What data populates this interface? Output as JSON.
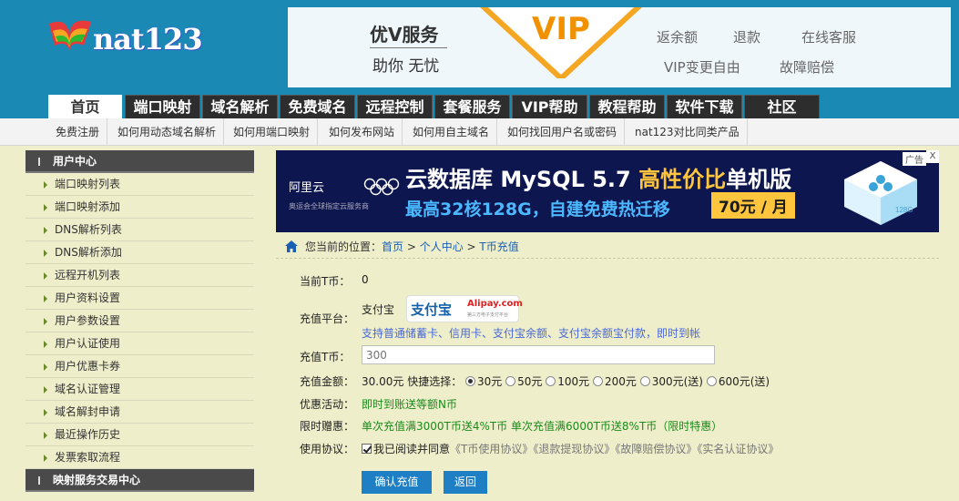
{
  "logo": {
    "text": "nat123"
  },
  "vip_banner": {
    "title": "优V服务",
    "subtitle": "助你 无忧",
    "badge": "VIP",
    "links": [
      "返余额",
      "退款",
      "在线客服",
      "VIP变更自由",
      "故障赔偿"
    ]
  },
  "nav": {
    "tabs": [
      "首页",
      "端口映射",
      "域名解析",
      "免费域名",
      "远程控制",
      "套餐服务",
      "VIP帮助",
      "教程帮助",
      "软件下载",
      "社区"
    ]
  },
  "subnav": {
    "links": [
      "免费注册",
      "如何用动态域名解析",
      "如何用端口映射",
      "如何发布网站",
      "如何用自主域名",
      "如何找回用户名或密码",
      "nat123对比同类产品"
    ]
  },
  "sidebar": {
    "section1": "用户中心",
    "items": [
      "端口映射列表",
      "端口映射添加",
      "DNS解析列表",
      "DNS解析添加",
      "远程开机列表",
      "用户资料设置",
      "用户参数设置",
      "用户认证使用",
      "用户优惠卡券",
      "域名认证管理",
      "域名解封申请",
      "最近操作历史",
      "发票索取流程"
    ],
    "section2": "映射服务交易中心"
  },
  "ad": {
    "brand": "阿里云",
    "brand_sub": "奥运会全球指定云服务商",
    "headline_pre": "云数据库 MySQL 5.7 ",
    "headline_hl": "高性价比",
    "headline_post": "单机版",
    "subline": "最高32核128G，自建免费热迁移",
    "price": "70元 / 月",
    "ad_tag": "广告",
    "close": "X",
    "cube_label": "128G"
  },
  "breadcrumb": {
    "prefix": "您当前的位置：",
    "items": [
      "首页",
      "个人中心",
      "T币充值"
    ],
    "sep": " > "
  },
  "form": {
    "balance_label": "当前T币：",
    "balance_value": "0",
    "platform_label": "充值平台：",
    "platform_value": "支付宝",
    "alipay_logo": "支付宝",
    "alipay_logo_en": "Alipay.com",
    "alipay_logo_sub": "第三方电子支付平台",
    "platform_note": "支持普通储蓄卡、信用卡、支付宝余额、支付宝余额宝付款，即时到帐",
    "amount_label": "充值T币：",
    "amount_placeholder": "300",
    "money_label": "充值金额：",
    "money_value": "30.00元",
    "quick_label": "快捷选择：",
    "quick_options": [
      "30元",
      "50元",
      "100元",
      "200元",
      "300元(送)",
      "600元(送)"
    ],
    "quick_selected": 0,
    "promo_label": "优惠活动：",
    "promo_value": "即时到账送等额N币",
    "limited_label": "限时赠惠：",
    "limited_value": "单次充值满3000T币送4%T币 单次充值满6000T币送8%T币（限时特惠）",
    "terms_label": "使用协议：",
    "terms_check": "我已阅读并同意",
    "terms_links": [
      "《T币使用协议》",
      "《退款提现协议》",
      "《故障赔偿协议》",
      "《实名认证协议》"
    ],
    "confirm_button": "确认充值",
    "back_button": "返回"
  }
}
